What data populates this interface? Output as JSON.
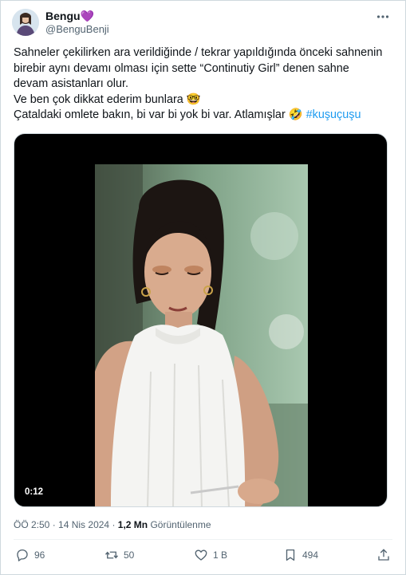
{
  "author": {
    "display_name": "Bengu",
    "name_emoji": "💜",
    "handle": "@BenguBenji"
  },
  "tweet": {
    "lines": [
      "Sahneler çekilirken ara verildiğinde / tekrar yapıldığında önceki sahnenin",
      "birebir aynı devamı olması için sette  “Continutiy Girl” denen sahne",
      "devam asistanları olur.",
      "Ve ben çok dikkat ederim bunlara 🤓",
      "Çataldaki omlete bakın, bi var bi yok bi var. Atlamışlar 🤣"
    ],
    "hashtag": "#kuşuçuşu"
  },
  "media": {
    "duration": "0:12"
  },
  "meta": {
    "time": "ÖÖ 2:50",
    "separator": "·",
    "date": "14 Nis 2024",
    "views_count": "1,2 Mn",
    "views_label": "Görüntülenme"
  },
  "actions": {
    "replies": "96",
    "reposts": "50",
    "likes": "1 B",
    "bookmarks": "494"
  },
  "icons": [
    "more-icon",
    "reply-icon",
    "repost-icon",
    "like-icon",
    "bookmark-icon",
    "share-icon"
  ],
  "colors": {
    "text": "#0f1419",
    "secondary": "#536471",
    "link": "#1d9bf0",
    "border": "#cfd9de"
  }
}
